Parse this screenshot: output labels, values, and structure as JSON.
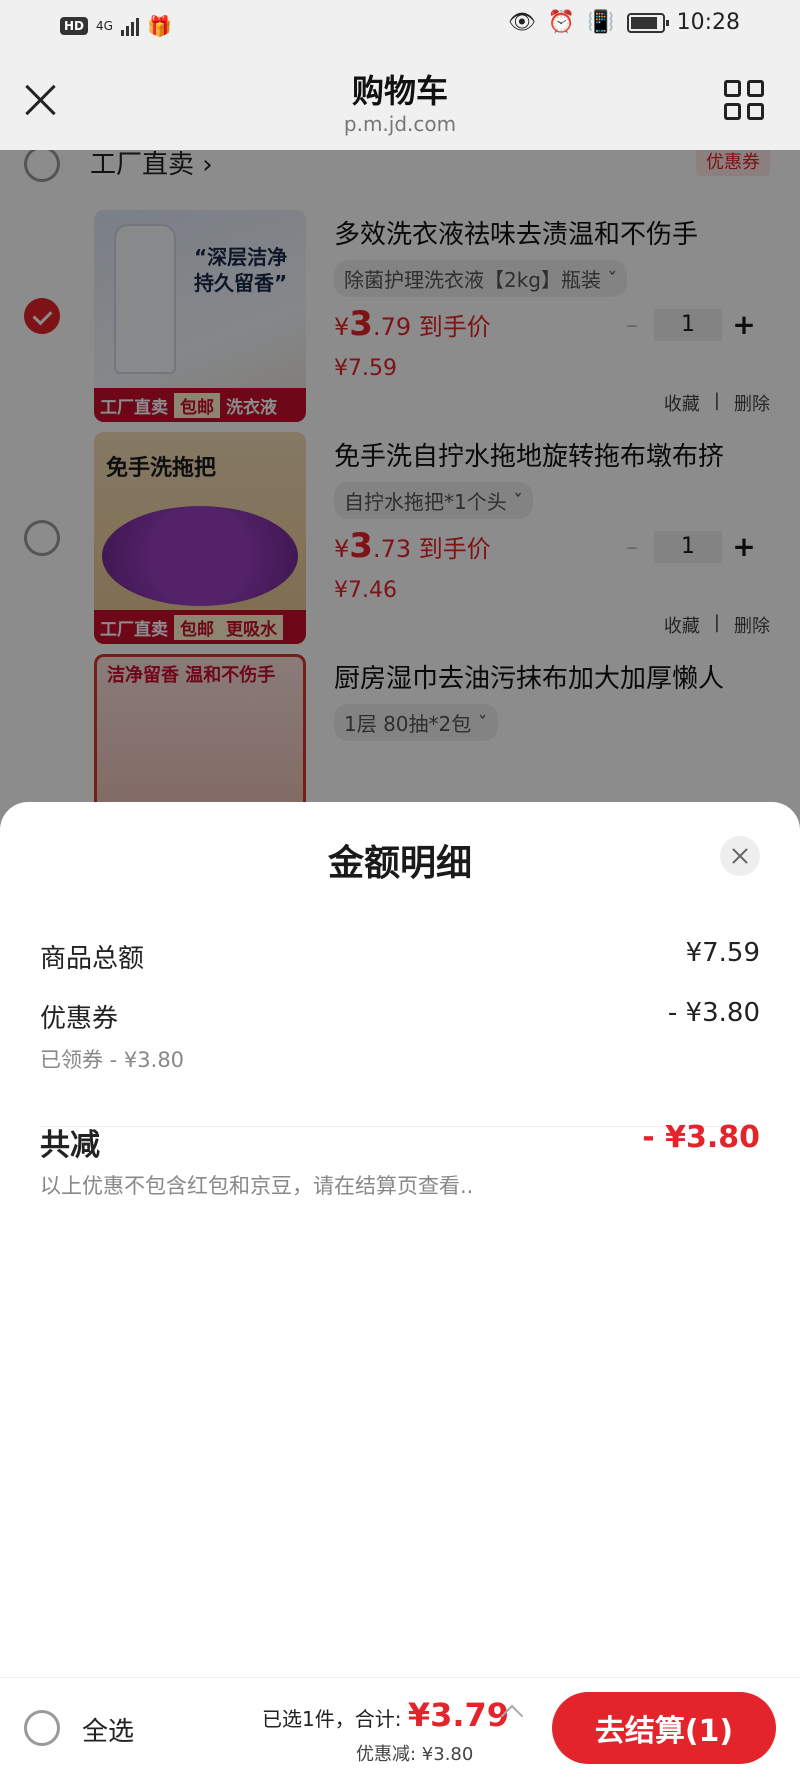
{
  "status_bar": {
    "time": "10:28",
    "network": "4G",
    "hd": "HD"
  },
  "header": {
    "title": "购物车",
    "subtitle": "p.m.jd.com"
  },
  "shop": {
    "name": "工厂直卖 ›",
    "coupon_tag": "优惠券"
  },
  "products": [
    {
      "name": "多效洗衣液祛味去渍温和不伤手",
      "spec": "除菌护理洗衣液【2kg】瓶装 ˇ",
      "price_prefix": "¥",
      "price_int": "3",
      "price_dec": ".79",
      "price_suffix": "到手价",
      "original_price": "¥7.59",
      "qty": "1",
      "thumb_tags": [
        "工厂直卖",
        "包邮",
        "洗衣液"
      ],
      "thumb_text": "“深层洁净 持久留香”",
      "checked": true,
      "fav": "收藏",
      "del": "删除"
    },
    {
      "name": "免手洗自拧水拖地旋转拖布墩布挤",
      "spec": "自拧水拖把*1个头 ˇ",
      "price_prefix": "¥",
      "price_int": "3",
      "price_dec": ".73",
      "price_suffix": "到手价",
      "original_price": "¥7.46",
      "qty": "1",
      "thumb_tags": [
        "工厂直卖",
        "包邮",
        "更吸水"
      ],
      "thumb_text": "免手洗拖把",
      "checked": false,
      "fav": "收藏",
      "del": "删除"
    },
    {
      "name": "厨房湿巾去油污抹布加大加厚懒人",
      "spec": "1层 80抽*2包 ˇ",
      "thumb_text": "洁净留香 温和不伤手",
      "checked": false
    }
  ],
  "sheet": {
    "title": "金额明细",
    "goods_total_label": "商品总额",
    "goods_total_value": "¥7.59",
    "coupon_label": "优惠券",
    "coupon_value": "- ¥3.80",
    "coupon_sub": "已领券 - ¥3.80",
    "total_discount_label": "共减",
    "total_discount_value": "- ¥3.80",
    "note": "以上优惠不包含红包和京豆，请在结算页查看.."
  },
  "footer": {
    "select_all": "全选",
    "selected_text": "已选1件，合计:",
    "total_price": "¥3.79",
    "saving_text": "优惠减: ¥3.80",
    "checkout": "去结算(1)"
  },
  "colors": {
    "accent": "#e3242b"
  }
}
